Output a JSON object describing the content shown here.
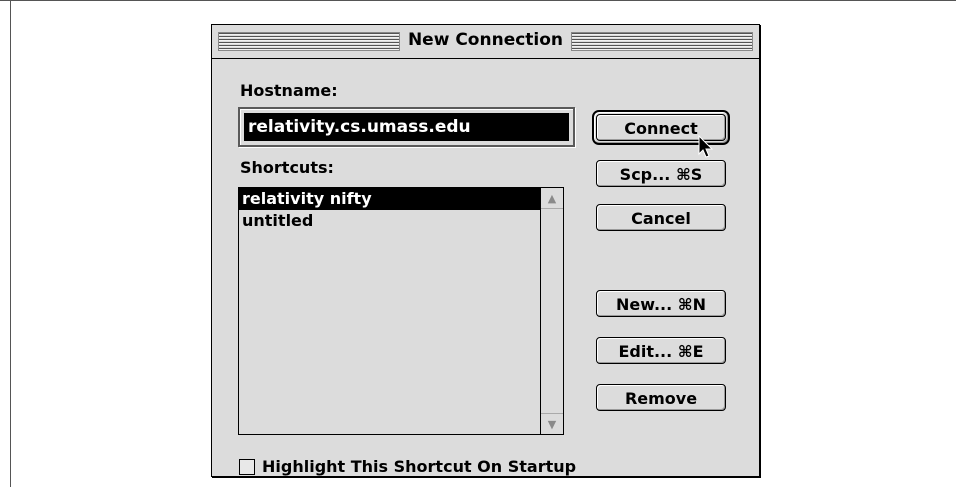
{
  "dialog": {
    "title": "New Connection",
    "hostname_label": "Hostname:",
    "hostname_value": "relativity.cs.umass.edu",
    "shortcuts_label": "Shortcuts:",
    "shortcuts": [
      {
        "label": "relativity nifty",
        "selected": true
      },
      {
        "label": "untitled",
        "selected": false
      }
    ],
    "checkbox_label": "Highlight This Shortcut On Startup",
    "checkbox_checked": false,
    "buttons": {
      "connect": "Connect",
      "scp": "Scp... ⌘S",
      "cancel": "Cancel",
      "new": "New... ⌘N",
      "edit": "Edit... ⌘E",
      "remove": "Remove"
    }
  }
}
